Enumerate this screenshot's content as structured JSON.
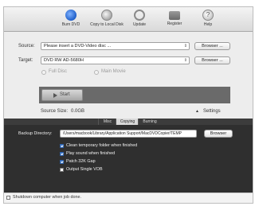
{
  "toolbar": {
    "items": [
      {
        "label": "Burn DVD"
      },
      {
        "label": "Copy to Local Disk"
      },
      {
        "label": "Update"
      },
      {
        "label": "Register"
      },
      {
        "label": "Help"
      }
    ]
  },
  "source": {
    "label": "Source:",
    "value": "Please insert a DVD-Video disc ...",
    "browse": "Browser ..."
  },
  "target": {
    "label": "Target:",
    "value": "DVD RW AD-5680H",
    "browse": "Browser ..."
  },
  "mode": {
    "full_disc": "Full Disc",
    "main_movie": "Main Movie"
  },
  "start": {
    "label": "Start"
  },
  "source_size": {
    "label": "Source Size:",
    "value": "0.0GB"
  },
  "settings": {
    "label": "Settings"
  },
  "tabs": [
    {
      "label": "Misc"
    },
    {
      "label": "Copying"
    },
    {
      "label": "Burning"
    }
  ],
  "backup": {
    "label": "Backup Directory:",
    "path": "/Users/macbook/Library/Application Support/MacDVDCopier/TEMP",
    "browse": "Browser"
  },
  "options": [
    {
      "label": "Clean temporary folder when finished",
      "checked": true
    },
    {
      "label": "Play sound when finished",
      "checked": true
    },
    {
      "label": "Patch 32K Gap",
      "checked": true
    },
    {
      "label": "Output Single VOB",
      "checked": false
    }
  ],
  "footer": {
    "label": "Shutdown computer when job done.",
    "checked": false
  }
}
